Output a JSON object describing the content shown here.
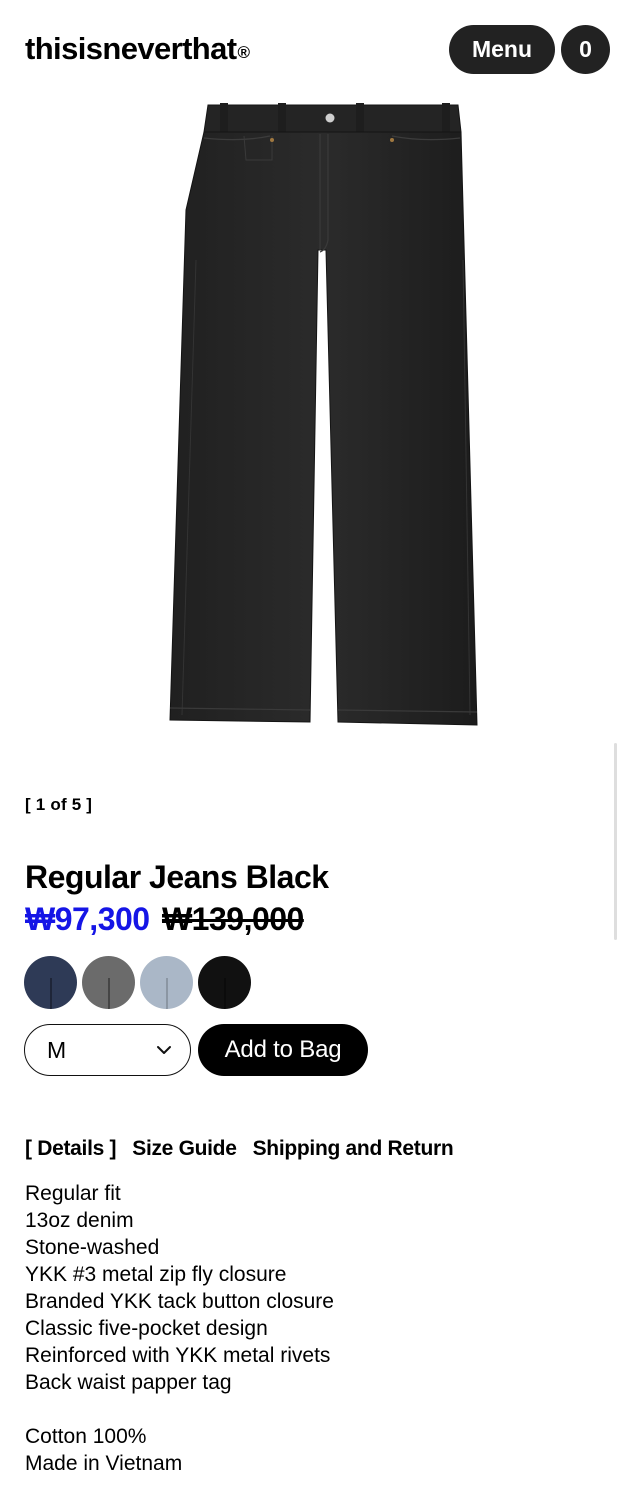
{
  "header": {
    "logo": "thisisneverthat",
    "logo_mark": "®",
    "menu_label": "Menu",
    "bag_count": "0"
  },
  "gallery": {
    "counter": "[ 1 of 5 ]"
  },
  "product": {
    "title": "Regular Jeans Black",
    "sale_price": "₩97,300",
    "original_price": "₩139,000",
    "swatch_colors": [
      "#2e3a56",
      "#6b6b6b",
      "#aab7c7",
      "#111111"
    ],
    "selected_size": "M",
    "add_to_bag_label": "Add to Bag"
  },
  "tabs": [
    {
      "label": "[ Details ]",
      "active": true
    },
    {
      "label": "Size Guide",
      "active": false
    },
    {
      "label": "Shipping and Return",
      "active": false
    }
  ],
  "details": {
    "features": [
      "Regular fit",
      "13oz denim",
      "Stone-washed",
      "YKK #3 metal zip fly closure",
      "Branded YKK tack button closure",
      "Classic five-pocket design",
      "Reinforced with YKK metal rivets",
      "Back waist papper tag"
    ],
    "material": "Cotton 100%",
    "origin": "Made in Vietnam"
  }
}
